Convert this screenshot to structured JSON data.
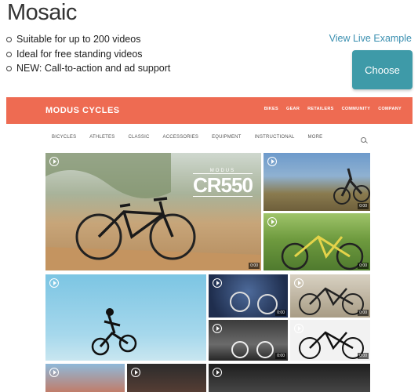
{
  "page": {
    "title": "Mosaic",
    "features": [
      "Suitable for up to 200 videos",
      "Ideal for free standing videos",
      "NEW: Call-to-action and ad support"
    ],
    "view_live_label": "View Live Example",
    "choose_label": "Choose"
  },
  "preview": {
    "brand": "MODUS CYCLES",
    "top_nav": [
      "BIKES",
      "GEAR",
      "RETAILERS",
      "COMMUNITY",
      "COMPANY"
    ],
    "sub_nav": [
      "BICYCLES",
      "ATHLETES",
      "CLASSIC",
      "ACCESSORIES",
      "EQUIPMENT",
      "INSTRUCTIONAL",
      "MORE"
    ],
    "hero": {
      "overlay_small": "MODUS",
      "overlay_large": "CR550"
    },
    "duration": "0:00",
    "colors": {
      "brand_bar": "#ee6b52",
      "choose_button": "#3e9aa8",
      "link": "#3a8fb0"
    }
  }
}
